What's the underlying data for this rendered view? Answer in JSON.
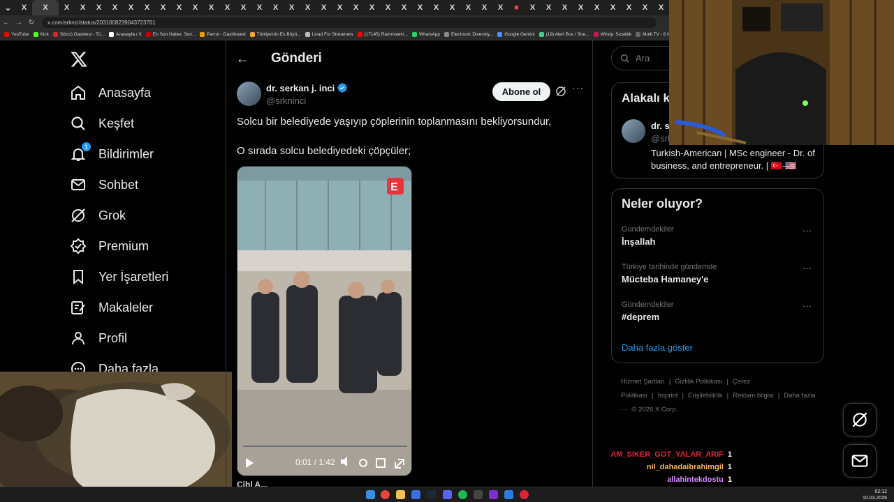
{
  "browser": {
    "url": "x.com/srknci/status/2031008239043723761",
    "active_tab_glyph": "X",
    "tab_glyph": "X",
    "bookmarks": [
      {
        "label": "YouTube",
        "color": "#ff0000"
      },
      {
        "label": "Kick",
        "color": "#53fc18"
      },
      {
        "label": "Sözcü Gazetesi - Tü...",
        "color": "#d22"
      },
      {
        "label": "Anasayfa / X",
        "color": "#fff"
      },
      {
        "label": "En Son Haber: Son...",
        "color": "#c00"
      },
      {
        "label": "Parrot - Dashboard",
        "color": "#e5a000"
      },
      {
        "label": "Türkiye'nin En Büyü...",
        "color": "#f5a623"
      },
      {
        "label": "Livad For Streamers",
        "color": "#bbb"
      },
      {
        "label": "(17145) Rammstein...",
        "color": "#ff0000"
      },
      {
        "label": "WhatsApp",
        "color": "#25d366"
      },
      {
        "label": "Electronic Diversity...",
        "color": "#888"
      },
      {
        "label": "Google Gemini",
        "color": "#4f8cff"
      },
      {
        "label": "(19) Alert Box / Stre...",
        "color": "#3ccf8e"
      },
      {
        "label": "Windy: Sıcaklık",
        "color": "#c2185b"
      },
      {
        "label": "Multi TV - 6 haber",
        "color": "#666"
      }
    ]
  },
  "nav": {
    "items": [
      {
        "label": "Anasayfa",
        "icon": "home-icon"
      },
      {
        "label": "Keşfet",
        "icon": "search-icon"
      },
      {
        "label": "Bildirimler",
        "icon": "bell-icon",
        "badge": "1"
      },
      {
        "label": "Sohbet",
        "icon": "mail-icon"
      },
      {
        "label": "Grok",
        "icon": "grok-icon"
      },
      {
        "label": "Premium",
        "icon": "premium-icon"
      },
      {
        "label": "Yer İşaretleri",
        "icon": "bookmark-icon"
      },
      {
        "label": "Makaleler",
        "icon": "article-icon"
      },
      {
        "label": "Profil",
        "icon": "profile-icon"
      },
      {
        "label": "Daha fazla",
        "icon": "more-icon"
      }
    ]
  },
  "post": {
    "header_title": "Gönderi",
    "author_name": "dr. serkan j. inci",
    "author_handle": "@srkninci",
    "subscribe_label": "Abone ol",
    "text_line1": "Solcu bir belediyede yaşıyıp çöplerinin toplanmasını bekliyorsundur,",
    "text_line2": "O sırada solcu belediyedeki çöpçüler;",
    "video_time": "0:01 / 1:42",
    "video_progress": 0.01,
    "next_author_partial": "Cihl A..."
  },
  "right": {
    "search_placeholder": "Ara",
    "related_title": "Alakalı k",
    "related_name": "dr. s",
    "related_handle": "@srk",
    "related_bio": "Turkish-American | MSc engineer - Dr. of business, and entrepreneur. | 🇹🇷-🇺🇸",
    "trends_title": "Neler oluyor?",
    "trends": [
      {
        "category": "Gündemdekiler",
        "name": "İnşallah"
      },
      {
        "category": "Türkiye tarihinde gündemde",
        "name": "Mücteba Hamaney'e"
      },
      {
        "category": "Gündemdekiler",
        "name": "#deprem"
      }
    ],
    "show_more": "Daha fazla göster",
    "footer": [
      "Hizmet Şartları",
      "|",
      "Gizlilik Politikası",
      "|",
      "Çerez Politikası",
      "|",
      "Imprint",
      "|",
      "Erişilebilirlik",
      "|",
      "Reklam bilgisi",
      "|",
      "Daha fazla ···",
      "© 2026 X Corp."
    ]
  },
  "chat": [
    {
      "user": "AM_SIKER_GOT_YALAR_ARIF",
      "count": "1",
      "color": "#e0263a"
    },
    {
      "user": "nil_dahadaibrahimgil",
      "count": "1",
      "color": "#f2b84b"
    },
    {
      "user": "allahintekdostu",
      "count": "1",
      "color": "#d58cff"
    },
    {
      "user": "PixieMoonx",
      "count": "1",
      "color": "#d58cff"
    }
  ],
  "taskbar": {
    "time": "02:12",
    "date": "10.03.2026"
  }
}
